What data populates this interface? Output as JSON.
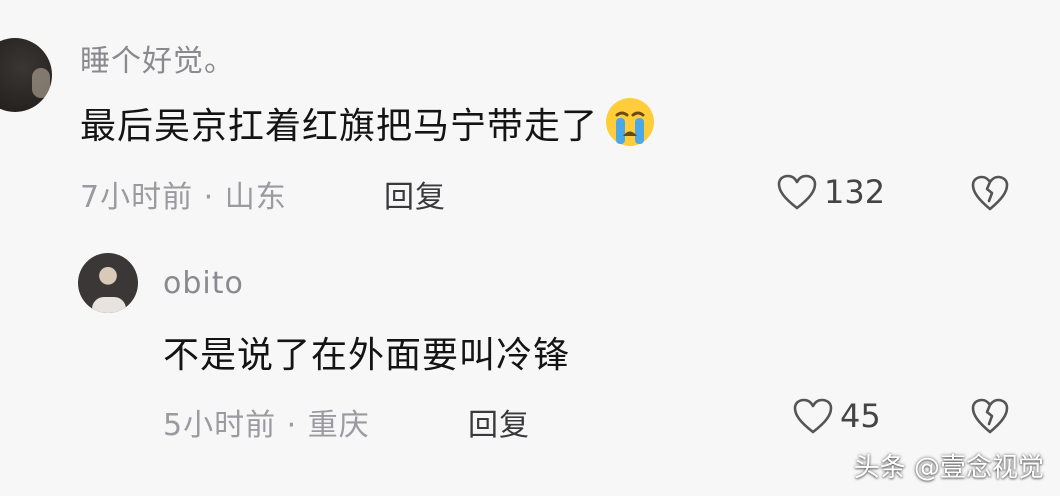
{
  "comments": [
    {
      "username": "睡个好觉。",
      "text": "最后吴京扛着红旗把马宁带走了",
      "emoji": "crying-face-emoji",
      "time": "7小时前",
      "separator": "·",
      "location": "山东",
      "reply_label": "回复",
      "likes": "132"
    },
    {
      "username": "obito",
      "text": "不是说了在外面要叫冷锋",
      "time": "5小时前",
      "separator": "·",
      "location": "重庆",
      "reply_label": "回复",
      "likes": "45"
    }
  ],
  "watermark": "头条 @壹念视觉",
  "colors": {
    "background": "#f7f7f8",
    "text": "#141414",
    "meta": "#9a9aa0",
    "icon": "#555555"
  }
}
